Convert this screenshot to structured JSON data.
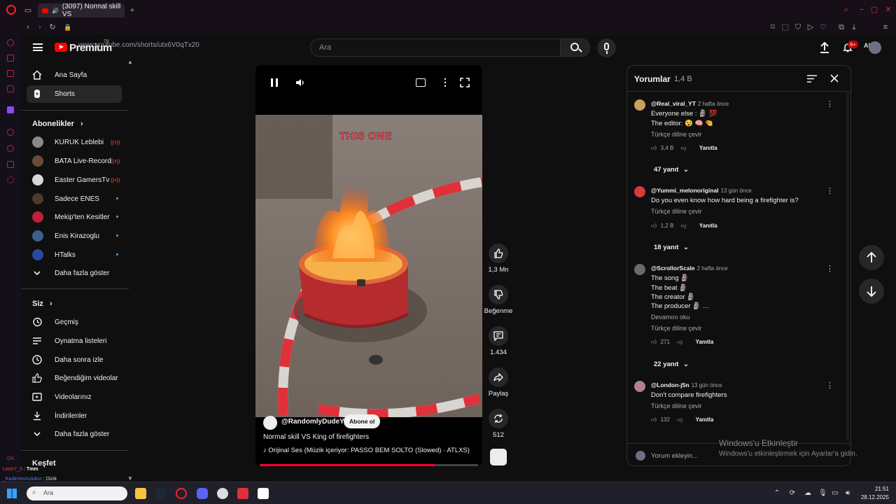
{
  "browser": {
    "tab_title": "(3097) Normal skill VS",
    "url": "www.youtube.com/shorts/utx6V0qTx20",
    "ai_label": "AI"
  },
  "header": {
    "logo": "Premium",
    "logo_region": "TR",
    "search_placeholder": "Ara",
    "notifications_badge": "9+"
  },
  "sidebar": {
    "main": [
      {
        "label": "Ana Sayfa",
        "icon": "home-icon"
      },
      {
        "label": "Shorts",
        "icon": "shorts-icon"
      }
    ],
    "subscriptions_title": "Abonelikler",
    "subscriptions": [
      {
        "name": "KURUK Leblebi",
        "status": "live",
        "avatar_color": "#8a8a8a"
      },
      {
        "name": "BATA Live-Record",
        "status": "live",
        "avatar_color": "#6b4a3c"
      },
      {
        "name": "Easter GamersTv",
        "status": "live",
        "avatar_color": "#d8d8d8"
      },
      {
        "name": "Sadece ENES",
        "status": "new",
        "avatar_color": "#4a3a30"
      },
      {
        "name": "Mekip'ten Kesitler",
        "status": "new",
        "avatar_color": "#c0203a"
      },
      {
        "name": "Enis Kirazoglu",
        "status": "new",
        "avatar_color": "#3b5f8a"
      },
      {
        "name": "HTalks",
        "status": "new",
        "avatar_color": "#2a4aa0"
      }
    ],
    "show_more_1": "Daha fazla göster",
    "you_title": "Siz",
    "you_items": [
      {
        "label": "Geçmiş",
        "icon": "history-icon"
      },
      {
        "label": "Oynatma listeleri",
        "icon": "playlists-icon"
      },
      {
        "label": "Daha sonra izle",
        "icon": "watch-later-icon"
      },
      {
        "label": "Beğendiğim videolar",
        "icon": "liked-videos-icon"
      },
      {
        "label": "Videolarınız",
        "icon": "your-videos-icon"
      },
      {
        "label": "İndirilenler",
        "icon": "downloads-icon"
      }
    ],
    "show_more_2": "Daha fazla göster",
    "explore_title": "Keşfet"
  },
  "video": {
    "overlay_text": "THIS ONE",
    "channel": "@RandomlyDudeYT",
    "subscribe_label": "Abone ol",
    "title": "Normal skill VS King of firefighters",
    "audio": "Orijinal Ses (Müzik içeriyor: PASSO BEM SOLTO (Slowed) · ATLXS)",
    "progress": 0.8
  },
  "actions": {
    "likes": "1,3 Mn",
    "dislike_label": "Beğenme",
    "comments": "1.434",
    "share_label": "Paylaş",
    "remix": "512"
  },
  "comments": {
    "title": "Yorumlar",
    "count": "1,4 B",
    "translate_label": "Türkçe diline çevir",
    "reply_label": "Yanıtla",
    "read_more": "Devamını oku",
    "items": [
      {
        "user": "@Real_viral_YT",
        "time": "2 hafta önce",
        "lines": [
          "Everyone else : 🗿 💯",
          "The editor: 😵 🧠 🤏"
        ],
        "likes": "3,4 B",
        "replies": "47 yanıt",
        "avatar_color": "#c9a15a"
      },
      {
        "user": "@Yummi_melonoriginal",
        "time": "13 gün önce",
        "lines": [
          "Do you even know how hard being a firefighter is?"
        ],
        "likes": "1,2 B",
        "replies": "18 yanıt",
        "avatar_color": "#d23c3c"
      },
      {
        "user": "@ScrollorScale",
        "time": "2 hafta önce",
        "lines": [
          "The song 🗿",
          "The beat 🗿",
          "The creator 🗿",
          "The producer 🗿 …"
        ],
        "likes": "271",
        "replies": "22 yanıt",
        "avatar_color": "#6a6a6a"
      },
      {
        "user": "@London-j5n",
        "time": "13 gün önce",
        "lines": [
          "Don't compare firefighters"
        ],
        "likes": "132",
        "replies": "",
        "avatar_color": "#b08090"
      }
    ],
    "input_placeholder": "Yorum ekleyin..."
  },
  "watermark": {
    "title": "Windows'u Etkinleştir",
    "subtitle": "Windows'u etkinleştirmek için Ayarlar'a gidin."
  },
  "taskbar": {
    "search_placeholder": "Ara",
    "time": "21:51",
    "date": "28.12.2025"
  },
  "overlay_chat": {
    "line1_user": "LeonY_0",
    "line1_text": "Tmm",
    "line2_user": "_Kadirreisisulubur",
    "line2_text": "Dizik",
    "tag": "GK"
  }
}
